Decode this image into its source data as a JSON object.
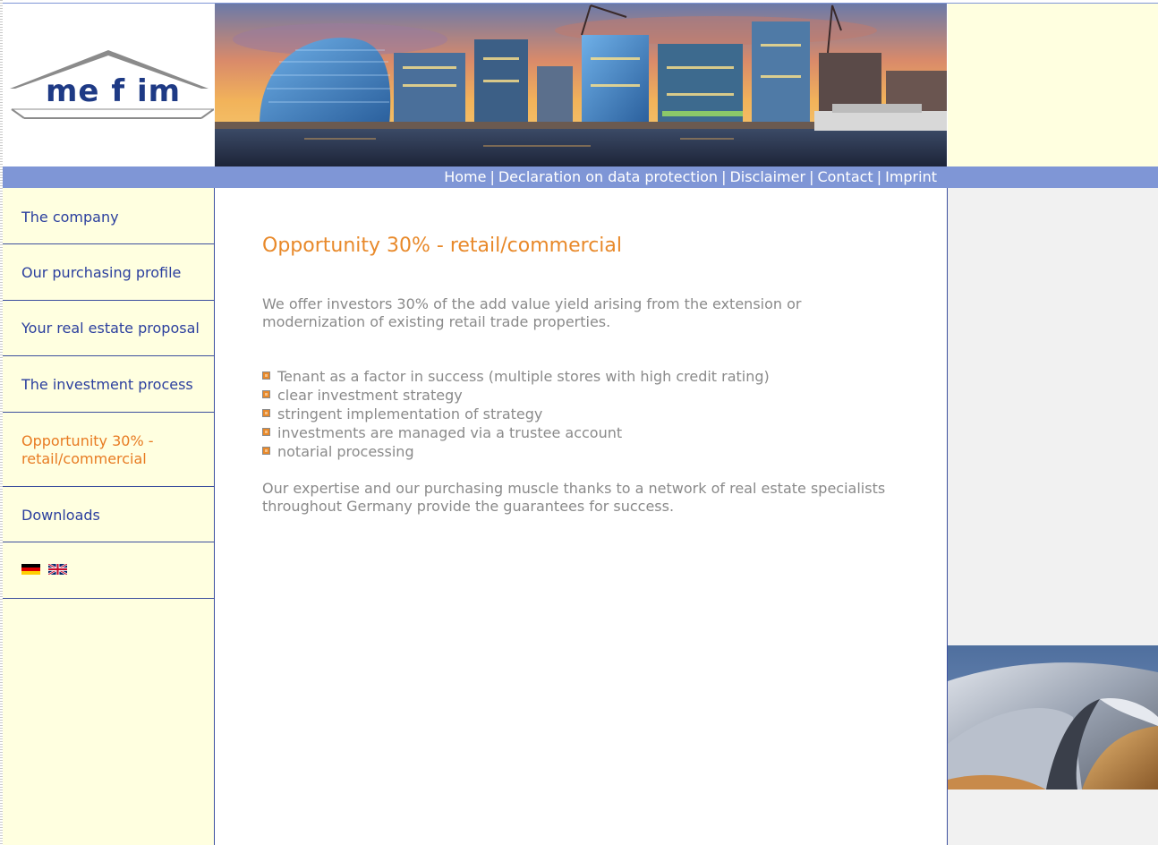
{
  "logo": {
    "text": "me f im"
  },
  "topnav": {
    "links": [
      "Home",
      "Declaration on data protection",
      "Disclaimer",
      "Contact",
      "Imprint"
    ],
    "separator": "|"
  },
  "sidebar": {
    "items": [
      {
        "label": "The company",
        "active": false
      },
      {
        "label": "Our purchasing profile",
        "active": false
      },
      {
        "label": "Your real estate proposal",
        "active": false
      },
      {
        "label": "The investment process",
        "active": false
      },
      {
        "label": "Opportunity 30% - retail/commercial",
        "active": true
      },
      {
        "label": "Downloads",
        "active": false
      }
    ],
    "languages": [
      "german-flag-icon",
      "uk-flag-icon"
    ]
  },
  "main": {
    "title": "Opportunity 30% - retail/commercial",
    "intro": "We offer investors 30% of the add value yield arising from the extension or modernization of existing retail trade properties.",
    "bullets": [
      "Tenant as a factor in success (multiple stores with high credit rating)",
      "clear investment strategy",
      "stringent implementation of strategy",
      "investments are managed via a trustee account",
      "notarial processing"
    ],
    "outro": "Our expertise and our purchasing muscle thanks to a network of real estate specialists throughout Germany provide the guarantees for success."
  },
  "colors": {
    "nav_bar": "#7f96d6",
    "sidebar_bg": "#ffffe0",
    "link": "#2b3f9e",
    "accent": "#e8892a",
    "body_text": "#8a8a8a"
  }
}
